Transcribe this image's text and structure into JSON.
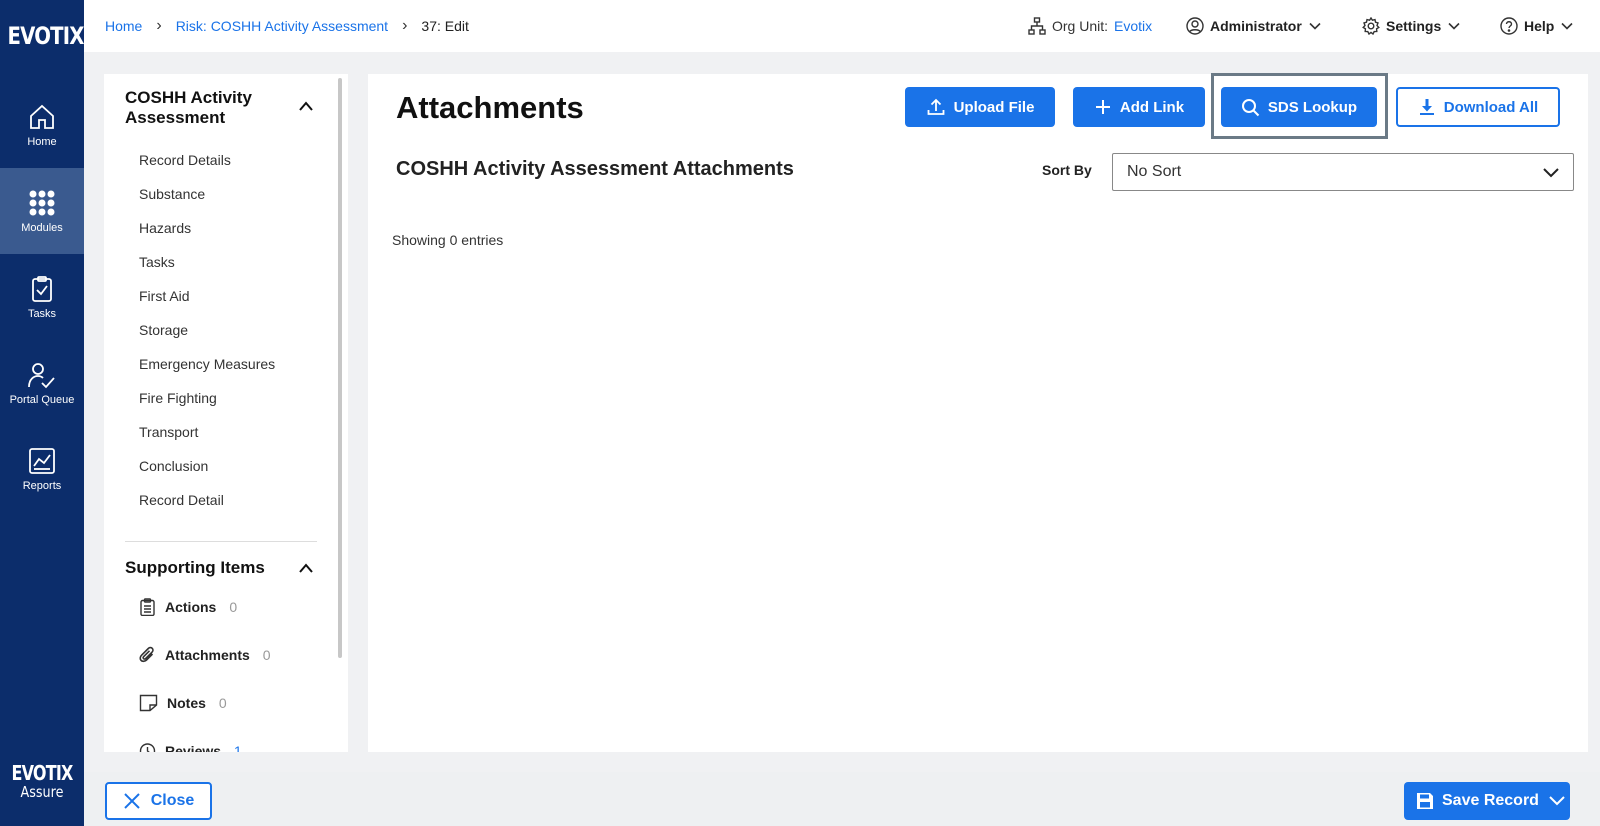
{
  "brand": {
    "logo": "EVOTIX",
    "footer_logo_top": "EVOTIX",
    "footer_logo_bottom": "Assure"
  },
  "rail": {
    "items": [
      {
        "label": "Home",
        "icon": "home-icon"
      },
      {
        "label": "Modules",
        "icon": "modules-grid-icon",
        "active": true
      },
      {
        "label": "Tasks",
        "icon": "clipboard-check-icon"
      },
      {
        "label": "Portal Queue",
        "icon": "user-check-icon"
      },
      {
        "label": "Reports",
        "icon": "chart-icon"
      }
    ]
  },
  "breadcrumb": {
    "home": "Home",
    "module": "Risk: COSHH Activity Assessment",
    "current": "37: Edit"
  },
  "topbar": {
    "org_unit_label": "Org Unit:",
    "org_unit_value": "Evotix",
    "user": "Administrator",
    "settings": "Settings",
    "help": "Help"
  },
  "sidebar": {
    "section_title": "COSHH Activity Assessment",
    "items": [
      "Record Details",
      "Substance",
      "Hazards",
      "Tasks",
      "First Aid",
      "Storage",
      "Emergency Measures",
      "Fire Fighting",
      "Transport",
      "Conclusion",
      "Record Detail"
    ],
    "supporting_title": "Supporting Items",
    "supporting": [
      {
        "label": "Actions",
        "count": "0",
        "icon": "clipboard-list-icon"
      },
      {
        "label": "Attachments",
        "count": "0",
        "icon": "paperclip-icon"
      },
      {
        "label": "Notes",
        "count": "0",
        "icon": "note-icon"
      },
      {
        "label": "Reviews",
        "count": "1",
        "icon": "review-icon"
      }
    ]
  },
  "main": {
    "title": "Attachments",
    "buttons": {
      "upload": "Upload File",
      "add_link": "Add Link",
      "sds_lookup": "SDS Lookup",
      "download_all": "Download All"
    },
    "subtitle": "COSHH Activity Assessment Attachments",
    "sort_label": "Sort By",
    "sort_value": "No Sort",
    "showing": "Showing 0 entries"
  },
  "footer": {
    "close": "Close",
    "save": "Save Record"
  },
  "colors": {
    "rail": "#0c2d6b",
    "rail_active": "#3a5a8f",
    "accent": "#1a73e8"
  }
}
